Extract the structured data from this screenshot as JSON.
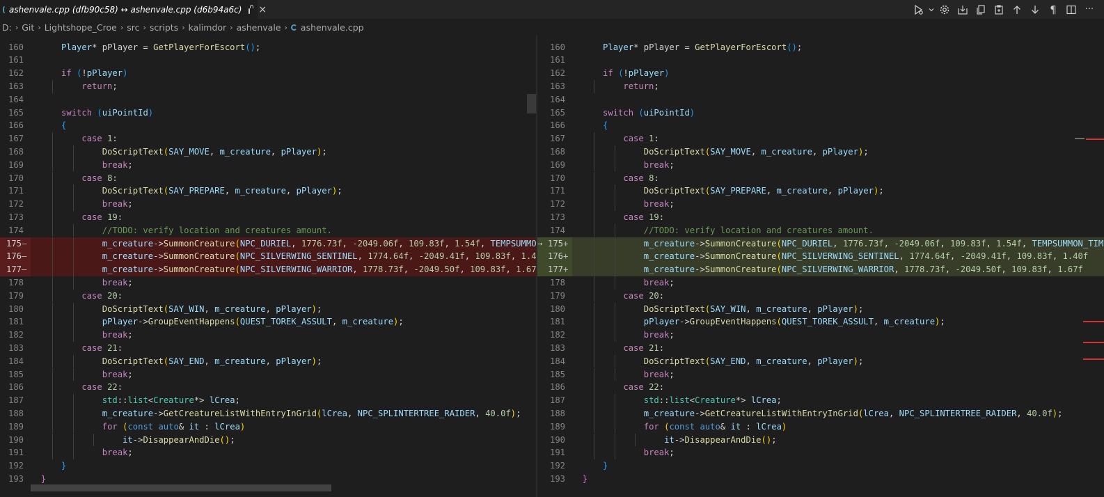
{
  "tab": {
    "title": "ashenvale.cpp (dfb90c58) ↔ ashenvale.cpp (d6b94a6c)",
    "close_glyph": "×"
  },
  "toolbar": {
    "icons": [
      "run-icon",
      "chevron-down-icon",
      "gear-icon",
      "save-download-icon",
      "copy-icon",
      "paste-icon",
      "arrow-up-icon",
      "arrow-down-icon",
      "pilcrow-icon",
      "split-editor-icon",
      "more-icon"
    ],
    "pilcrow": "¶",
    "more": "···"
  },
  "breadcrumb": {
    "segments": [
      "D:",
      "Git",
      "Lightshope_Croe",
      "src",
      "scripts",
      "kalimdor",
      "ashenvale",
      "ashenvale.cpp"
    ],
    "separator": "›"
  },
  "colors": {
    "deleted_bg": "#4b1818",
    "inserted_bg": "#373d29",
    "editor_bg": "#1e1e1e"
  },
  "lines": [
    {
      "n": "160",
      "indent": 1,
      "t": [
        [
          "va",
          "Player"
        ],
        [
          "op",
          "* pPlayer = "
        ],
        [
          "fn",
          "GetPlayerForEscort"
        ],
        [
          "b3",
          "()"
        ],
        [
          "op",
          ";"
        ]
      ]
    },
    {
      "n": "161",
      "indent": 0,
      "t": []
    },
    {
      "n": "162",
      "indent": 1,
      "t": [
        [
          "ctl",
          "if"
        ],
        [
          "op",
          " "
        ],
        [
          "b3",
          "("
        ],
        [
          "op",
          "!"
        ],
        [
          "va",
          "pPlayer"
        ],
        [
          "b3",
          ")"
        ]
      ]
    },
    {
      "n": "163",
      "indent": 2,
      "t": [
        [
          "ctl",
          "return"
        ],
        [
          "op",
          ";"
        ]
      ]
    },
    {
      "n": "164",
      "indent": 0,
      "t": []
    },
    {
      "n": "165",
      "indent": 1,
      "t": [
        [
          "ctl",
          "switch"
        ],
        [
          "op",
          " "
        ],
        [
          "b3",
          "("
        ],
        [
          "va",
          "uiPointId"
        ],
        [
          "b3",
          ")"
        ]
      ]
    },
    {
      "n": "166",
      "indent": 1,
      "t": [
        [
          "b3",
          "{"
        ]
      ]
    },
    {
      "n": "167",
      "indent": 2,
      "t": [
        [
          "ctl",
          "case"
        ],
        [
          "op",
          " "
        ],
        [
          "nu",
          "1"
        ],
        [
          "op",
          ":"
        ]
      ]
    },
    {
      "n": "168",
      "indent": 3,
      "t": [
        [
          "fn",
          "DoScriptText"
        ],
        [
          "b1",
          "("
        ],
        [
          "va",
          "SAY_MOVE"
        ],
        [
          "op",
          ", "
        ],
        [
          "va",
          "m_creature"
        ],
        [
          "op",
          ", "
        ],
        [
          "va",
          "pPlayer"
        ],
        [
          "b1",
          ")"
        ],
        [
          "op",
          ";"
        ]
      ]
    },
    {
      "n": "169",
      "indent": 3,
      "t": [
        [
          "ctl",
          "break"
        ],
        [
          "op",
          ";"
        ]
      ]
    },
    {
      "n": "170",
      "indent": 2,
      "t": [
        [
          "ctl",
          "case"
        ],
        [
          "op",
          " "
        ],
        [
          "nu",
          "8"
        ],
        [
          "op",
          ":"
        ]
      ]
    },
    {
      "n": "171",
      "indent": 3,
      "t": [
        [
          "fn",
          "DoScriptText"
        ],
        [
          "b1",
          "("
        ],
        [
          "va",
          "SAY_PREPARE"
        ],
        [
          "op",
          ", "
        ],
        [
          "va",
          "m_creature"
        ],
        [
          "op",
          ", "
        ],
        [
          "va",
          "pPlayer"
        ],
        [
          "b1",
          ")"
        ],
        [
          "op",
          ";"
        ]
      ]
    },
    {
      "n": "172",
      "indent": 3,
      "t": [
        [
          "ctl",
          "break"
        ],
        [
          "op",
          ";"
        ]
      ]
    },
    {
      "n": "173",
      "indent": 2,
      "t": [
        [
          "ctl",
          "case"
        ],
        [
          "op",
          " "
        ],
        [
          "nu",
          "19"
        ],
        [
          "op",
          ":"
        ]
      ]
    },
    {
      "n": "174",
      "indent": 3,
      "t": [
        [
          "cm",
          "//TODO: verify location and creatures amount."
        ]
      ]
    },
    {
      "n": "175",
      "indent": 3,
      "diff": true,
      "t": [
        [
          "va",
          "m_creature"
        ],
        [
          "op",
          "->"
        ],
        [
          "fn",
          "SummonCreature"
        ],
        [
          "b1",
          "("
        ],
        [
          "va",
          "NPC_DURIEL"
        ],
        [
          "op",
          ", "
        ],
        [
          "nu",
          "1776.73f"
        ],
        [
          "op",
          ", "
        ],
        [
          "nu",
          "-2049.06f"
        ],
        [
          "op",
          ", "
        ],
        [
          "nu",
          "109.83f"
        ],
        [
          "op",
          ", "
        ],
        [
          "nu",
          "1.54f"
        ],
        [
          "op",
          ", "
        ],
        [
          "va",
          "TEMPSUMMON_TIMED_OOC_DESPAWN"
        ]
      ]
    },
    {
      "n": "176",
      "indent": 3,
      "diff": true,
      "t": [
        [
          "va",
          "m_creature"
        ],
        [
          "op",
          "->"
        ],
        [
          "fn",
          "SummonCreature"
        ],
        [
          "b1",
          "("
        ],
        [
          "va",
          "NPC_SILVERWING_SENTINEL"
        ],
        [
          "op",
          ", "
        ],
        [
          "nu",
          "1774.64f"
        ],
        [
          "op",
          ", "
        ],
        [
          "nu",
          "-2049.41f"
        ],
        [
          "op",
          ", "
        ],
        [
          "nu",
          "109.83f"
        ],
        [
          "op",
          ", "
        ],
        [
          "nu",
          "1.40f"
        ]
      ]
    },
    {
      "n": "177",
      "indent": 3,
      "diff": true,
      "t": [
        [
          "va",
          "m_creature"
        ],
        [
          "op",
          "->"
        ],
        [
          "fn",
          "SummonCreature"
        ],
        [
          "b1",
          "("
        ],
        [
          "va",
          "NPC_SILVERWING_WARRIOR"
        ],
        [
          "op",
          ", "
        ],
        [
          "nu",
          "1778.73f"
        ],
        [
          "op",
          ", "
        ],
        [
          "nu",
          "-2049.50f"
        ],
        [
          "op",
          ", "
        ],
        [
          "nu",
          "109.83f"
        ],
        [
          "op",
          ", "
        ],
        [
          "nu",
          "1.67f"
        ]
      ]
    },
    {
      "n": "178",
      "indent": 3,
      "t": [
        [
          "ctl",
          "break"
        ],
        [
          "op",
          ";"
        ]
      ]
    },
    {
      "n": "179",
      "indent": 2,
      "t": [
        [
          "ctl",
          "case"
        ],
        [
          "op",
          " "
        ],
        [
          "nu",
          "20"
        ],
        [
          "op",
          ":"
        ]
      ]
    },
    {
      "n": "180",
      "indent": 3,
      "t": [
        [
          "fn",
          "DoScriptText"
        ],
        [
          "b1",
          "("
        ],
        [
          "va",
          "SAY_WIN"
        ],
        [
          "op",
          ", "
        ],
        [
          "va",
          "m_creature"
        ],
        [
          "op",
          ", "
        ],
        [
          "va",
          "pPlayer"
        ],
        [
          "b1",
          ")"
        ],
        [
          "op",
          ";"
        ]
      ]
    },
    {
      "n": "181",
      "indent": 3,
      "t": [
        [
          "va",
          "pPlayer"
        ],
        [
          "op",
          "->"
        ],
        [
          "fn",
          "GroupEventHappens"
        ],
        [
          "b1",
          "("
        ],
        [
          "va",
          "QUEST_TOREK_ASSULT"
        ],
        [
          "op",
          ", "
        ],
        [
          "va",
          "m_creature"
        ],
        [
          "b1",
          ")"
        ],
        [
          "op",
          ";"
        ]
      ]
    },
    {
      "n": "182",
      "indent": 3,
      "t": [
        [
          "ctl",
          "break"
        ],
        [
          "op",
          ";"
        ]
      ]
    },
    {
      "n": "183",
      "indent": 2,
      "t": [
        [
          "ctl",
          "case"
        ],
        [
          "op",
          " "
        ],
        [
          "nu",
          "21"
        ],
        [
          "op",
          ":"
        ]
      ]
    },
    {
      "n": "184",
      "indent": 3,
      "t": [
        [
          "fn",
          "DoScriptText"
        ],
        [
          "b1",
          "("
        ],
        [
          "va",
          "SAY_END"
        ],
        [
          "op",
          ", "
        ],
        [
          "va",
          "m_creature"
        ],
        [
          "op",
          ", "
        ],
        [
          "va",
          "pPlayer"
        ],
        [
          "b1",
          ")"
        ],
        [
          "op",
          ";"
        ]
      ]
    },
    {
      "n": "185",
      "indent": 3,
      "t": [
        [
          "ctl",
          "break"
        ],
        [
          "op",
          ";"
        ]
      ]
    },
    {
      "n": "186",
      "indent": 2,
      "t": [
        [
          "ctl",
          "case"
        ],
        [
          "op",
          " "
        ],
        [
          "nu",
          "22"
        ],
        [
          "op",
          ":"
        ]
      ]
    },
    {
      "n": "187",
      "indent": 3,
      "t": [
        [
          "ty",
          "std"
        ],
        [
          "op",
          "::"
        ],
        [
          "ty",
          "list"
        ],
        [
          "op",
          "<"
        ],
        [
          "ty",
          "Creature"
        ],
        [
          "op",
          "*> "
        ],
        [
          "va",
          "lCrea"
        ],
        [
          "op",
          ";"
        ]
      ]
    },
    {
      "n": "188",
      "indent": 3,
      "t": [
        [
          "va",
          "m_creature"
        ],
        [
          "op",
          "->"
        ],
        [
          "fn",
          "GetCreatureListWithEntryInGrid"
        ],
        [
          "b1",
          "("
        ],
        [
          "va",
          "lCrea"
        ],
        [
          "op",
          ", "
        ],
        [
          "va",
          "NPC_SPLINTERTREE_RAIDER"
        ],
        [
          "op",
          ", "
        ],
        [
          "nu",
          "40.0f"
        ],
        [
          "b1",
          ")"
        ],
        [
          "op",
          ";"
        ]
      ]
    },
    {
      "n": "189",
      "indent": 3,
      "t": [
        [
          "ctl",
          "for"
        ],
        [
          "op",
          " "
        ],
        [
          "b1",
          "("
        ],
        [
          "kw",
          "const"
        ],
        [
          "op",
          " "
        ],
        [
          "kw",
          "auto"
        ],
        [
          "op",
          "& "
        ],
        [
          "va",
          "it"
        ],
        [
          "op",
          " : "
        ],
        [
          "va",
          "lCrea"
        ],
        [
          "b1",
          ")"
        ]
      ]
    },
    {
      "n": "190",
      "indent": 4,
      "t": [
        [
          "va",
          "it"
        ],
        [
          "op",
          "->"
        ],
        [
          "fn",
          "DisappearAndDie"
        ],
        [
          "b1",
          "()"
        ],
        [
          "op",
          ";"
        ]
      ]
    },
    {
      "n": "191",
      "indent": 3,
      "t": [
        [
          "ctl",
          "break"
        ],
        [
          "op",
          ";"
        ]
      ]
    },
    {
      "n": "192",
      "indent": 1,
      "t": [
        [
          "b3",
          "}"
        ]
      ]
    },
    {
      "n": "193",
      "indent": 0,
      "t": [
        [
          "b2",
          "}"
        ]
      ]
    }
  ],
  "left_markers": {
    "175": "—",
    "176": "—",
    "177": "—"
  },
  "right_markers": {
    "175": "+",
    "176": "+",
    "177": "+"
  },
  "right_arrow": "→"
}
